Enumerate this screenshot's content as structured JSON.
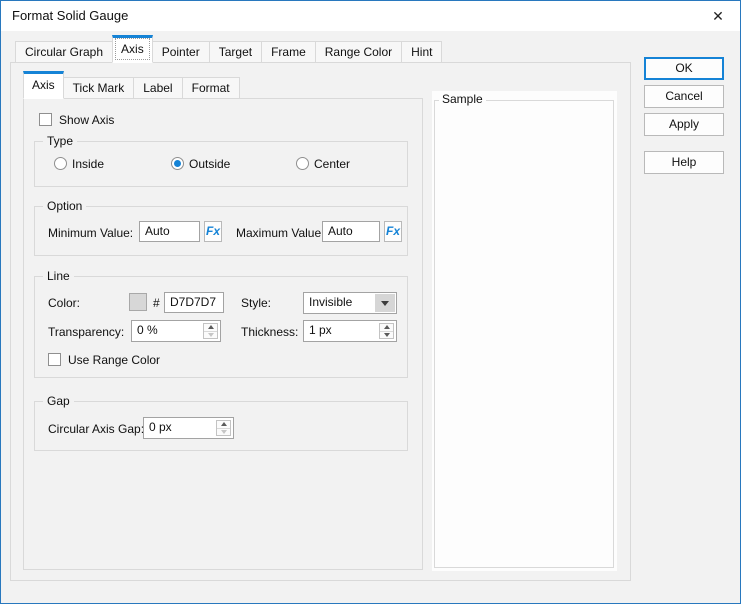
{
  "colors": {
    "accent": "#1583d6",
    "dialog-border": "#2878be",
    "swatch": "#D7D7D7"
  },
  "window": {
    "title": "Format Solid Gauge"
  },
  "icons": {
    "close": "✕"
  },
  "tabs": {
    "selected": "Axis",
    "items": [
      {
        "label": "Circular Graph"
      },
      {
        "label": "Axis"
      },
      {
        "label": "Pointer"
      },
      {
        "label": "Target"
      },
      {
        "label": "Frame"
      },
      {
        "label": "Range Color"
      },
      {
        "label": "Hint"
      }
    ]
  },
  "subtabs": {
    "selected": "Axis",
    "items": [
      "Axis",
      "Tick Mark",
      "Label",
      "Format"
    ]
  },
  "axis_panel": {
    "show_axis": {
      "label": "Show Axis",
      "checked": false
    },
    "type_group": {
      "title": "Type",
      "options": [
        {
          "label": "Inside",
          "selected": false
        },
        {
          "label": "Outside",
          "selected": true
        },
        {
          "label": "Center",
          "selected": false
        }
      ]
    },
    "option_group": {
      "title": "Option",
      "minimum": {
        "label": "Minimum Value:",
        "value": "Auto",
        "fx": "Fx"
      },
      "maximum": {
        "label": "Maximum Value:",
        "value": "Auto",
        "fx": "Fx"
      }
    },
    "line_group": {
      "title": "Line",
      "color": {
        "label": "Color:",
        "hash": "#",
        "value": "D7D7D7",
        "swatch": "#D7D7D7"
      },
      "style": {
        "label": "Style:",
        "value": "Invisible"
      },
      "transparency": {
        "label": "Transparency:",
        "value": "0 %"
      },
      "thickness": {
        "label": "Thickness:",
        "value": "1 px"
      },
      "use_range_color": {
        "label": "Use Range Color",
        "checked": false
      }
    },
    "gap_group": {
      "title": "Gap",
      "circular_axis_gap": {
        "label": "Circular Axis Gap:",
        "value": "0 px"
      }
    }
  },
  "sample_group": {
    "title": "Sample"
  },
  "buttons": {
    "ok": "OK",
    "cancel": "Cancel",
    "apply": "Apply",
    "help": "Help"
  }
}
